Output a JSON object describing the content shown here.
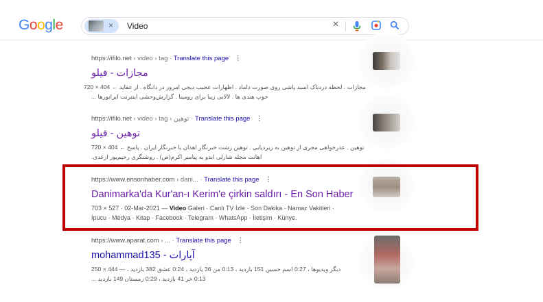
{
  "header": {
    "logo_letters": [
      {
        "ch": "G",
        "color": "#4285f4"
      },
      {
        "ch": "o",
        "color": "#ea4335"
      },
      {
        "ch": "o",
        "color": "#fbbc05"
      },
      {
        "ch": "g",
        "color": "#4285f4"
      },
      {
        "ch": "l",
        "color": "#34a853"
      },
      {
        "ch": "e",
        "color": "#ea4335"
      }
    ],
    "search": {
      "chip_close": "×",
      "query": "Video",
      "clear_icon": "×",
      "mic_icon": "microphone-icon",
      "lens_icon": "camera-lens-icon",
      "search_icon": "magnifier-icon"
    }
  },
  "results": [
    {
      "url": "https://ifilo.net",
      "path": "› video › tag",
      "translate": "Translate this page",
      "title": "مجازات - فیلو",
      "snippet": [
        "مجازات . لحظه دردناک اسید پاشی روی صورت داماد . اظهارات عجیب دیجی امروز در دانگاه . از عقاید ← 404 × 720",
        "خوب هندی ها . لالایی زیبا برای رومینا . گزارش‌وحشی اینترنت ایرانورها ..."
      ]
    },
    {
      "url": "https://ifilo.net",
      "path": "› video › tag › توهین",
      "translate": "Translate this page",
      "title": "توهین - فیلو",
      "snippet": [
        "توهین . عذرخواهی مجری از توهین به زیردپایی . توهین زشت خبرنگار اهدان با خبرنگار ایران . پاسخ ← 404 × 720",
        "اهانت مجله شارلی ابدو به پیامبر اکرم(ص) . روشنگری رحیم‌پور ازغدی."
      ]
    },
    {
      "url": "https://www.ensonhaber.com",
      "path": "› dani...",
      "translate": "Translate this page",
      "title": "Danimarka'da Kur'an-ı Kerim'e çirkin saldırı - En Son Haber",
      "snippet_meta": "703 × 527 · 02-Mar-2021 —",
      "snippet_bold": "Video",
      "snippet_rest": "Galeri · Canlı TV İzle · Son Dakika · Namaz Vakitleri ·",
      "snippet_line2": "İpucu · Medya · Kitap · Facebook · Telegram · WhatsApp · İletişim · Künye."
    },
    {
      "url": "https://www.aparat.com",
      "path": "› ...",
      "translate": "Translate this page",
      "title": "آپارات - mohammad135",
      "snippet": [
        "دیگر ویدیوها ، 0:27 اسم حسین 151 بازدید ، 0:13 من 36 بازدید ، 0:24 عشق 382 بازدید ، — 444 × 250",
        "0:13 خر 41 بازدید ، 0:29 زمستان 149 بازدید ..."
      ]
    }
  ]
}
